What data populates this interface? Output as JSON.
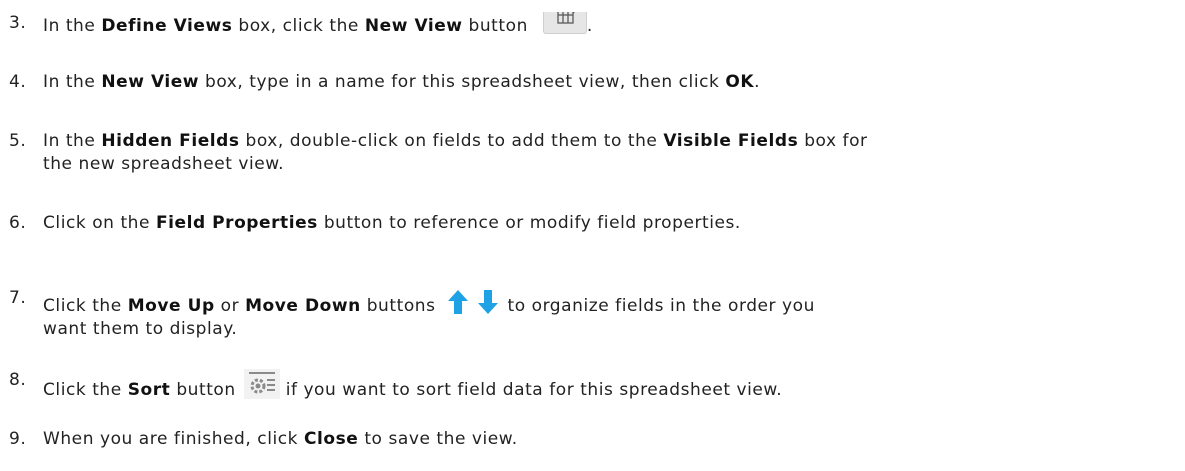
{
  "steps": [
    {
      "number": "3.",
      "t1": "In the ",
      "b1": "Define Views",
      "t2": " box, click the ",
      "b2": "New View",
      "t3": " button ",
      "icon": "new-view-icon",
      "t4": "."
    },
    {
      "number": "4.",
      "t1": "In the ",
      "b1": "New View",
      "t2": " box, type in a name for this spreadsheet view, then click ",
      "b2": "OK",
      "t3": "."
    },
    {
      "number": "5.",
      "t1": "In the ",
      "b1": "Hidden Fields",
      "t2": " box, double-click on fields to add them to the ",
      "b2": "Visible Fields",
      "t3": " box for",
      "line2": "the new spreadsheet view."
    },
    {
      "number": "6.",
      "t1": "Click on the ",
      "b1": "Field Properties",
      "t2": " button to reference or modify field properties."
    },
    {
      "number": "7.",
      "t1": "Click the ",
      "b1": "Move Up",
      "t2": " or ",
      "b2": "Move Down",
      "t3": " buttons",
      "icon": "move-up-down-arrows-icon",
      "t4": "to organize fields in the order you",
      "line2": "want them to display."
    },
    {
      "number": "8.",
      "t1": "Click the ",
      "b1": "Sort",
      "t2": " button",
      "icon": "sort-icon",
      "t3": "if you want to sort field data for this spreadsheet view."
    },
    {
      "number": "9.",
      "t1": "When you are finished, click ",
      "b1": "Close",
      "t2": " to save the view."
    }
  ],
  "colors": {
    "text": "#222222",
    "arrow_blue": "#1fa1e6",
    "icon_grey": "#9b9b9b"
  }
}
